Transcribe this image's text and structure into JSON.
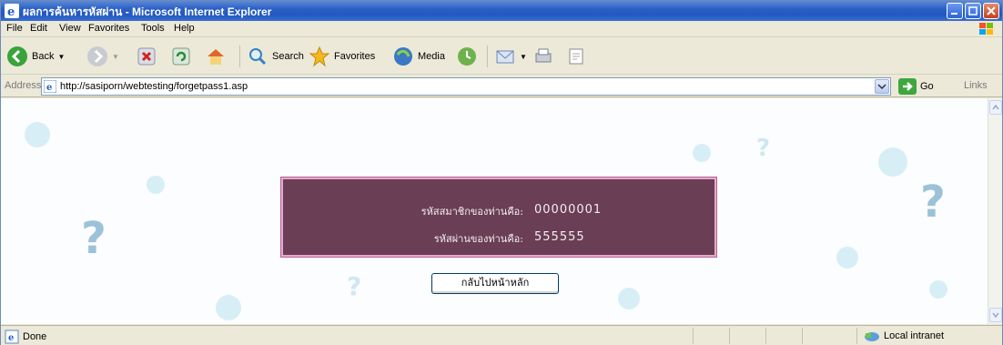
{
  "window": {
    "title": "ผลการค้นหารหัสผ่าน - Microsoft Internet Explorer"
  },
  "menu": {
    "items": [
      "File",
      "Edit",
      "View",
      "Favorites",
      "Tools",
      "Help"
    ]
  },
  "toolbar": {
    "back_label": "Back",
    "search_label": "Search",
    "favorites_label": "Favorites",
    "media_label": "Media"
  },
  "address": {
    "label": "Address",
    "url": "http://sasiporn/webtesting/forgetpass1.asp",
    "go_label": "Go",
    "links_label": "Links"
  },
  "result": {
    "member_id_label": "รหัสสมาชิกของท่านคือ:",
    "member_id_value": "00000001",
    "password_label": "รหัสผ่านของท่านคือ:",
    "password_value": "555555",
    "back_button_label": "กลับไปหน้าหลัก"
  },
  "status": {
    "left_text": "Done",
    "zone_text": "Local intranet"
  },
  "colors": {
    "panel_bg": "#6a3e54",
    "panel_border": "#e6a8cf",
    "titlebar": "#2258c0"
  }
}
